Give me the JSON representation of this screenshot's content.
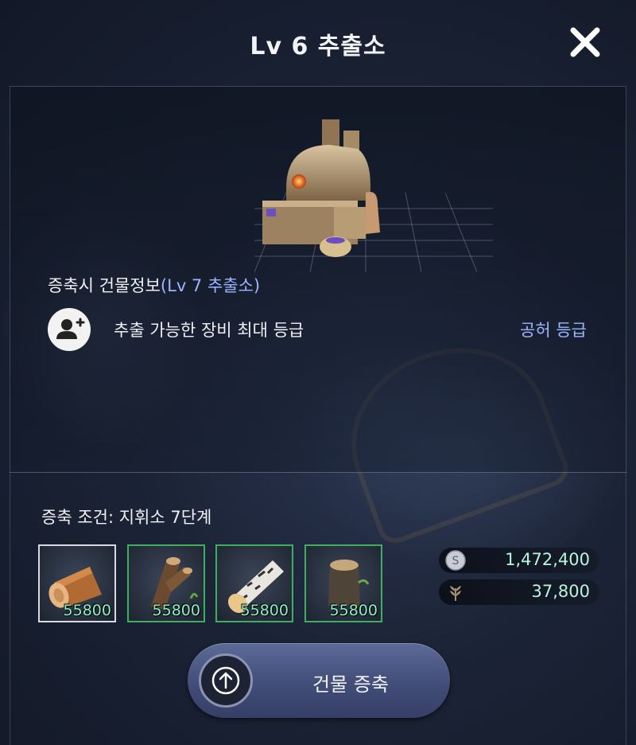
{
  "header": {
    "title": "Lv 6 추출소",
    "close_icon": "close-icon"
  },
  "building_info": {
    "heading_prefix": "증축시 건물정보",
    "heading_accent": "(Lv 7 추출소)",
    "stat_icon": "user-plus-icon",
    "stat_label": "추출 가능한 장비 최대 등급",
    "stat_value": "공허 등급"
  },
  "requirement": {
    "label": "증축 조건: 지휘소 7단계",
    "materials": [
      {
        "icon": "log-icon",
        "quantity": "55800",
        "selected": true
      },
      {
        "icon": "branching-log-icon",
        "quantity": "55800",
        "selected": false
      },
      {
        "icon": "birch-log-icon",
        "quantity": "55800",
        "selected": false
      },
      {
        "icon": "tree-stump-icon",
        "quantity": "55800",
        "selected": false
      }
    ],
    "costs": [
      {
        "icon": "silver-coin-icon",
        "value": "1,472,400"
      },
      {
        "icon": "grain-icon",
        "value": "37,800"
      }
    ]
  },
  "action": {
    "label": "건물 증축",
    "icon": "up-arrow-icon"
  },
  "colors": {
    "accent": "#9db5ff",
    "quantity": "#8ef0c8",
    "green_border": "#3fae63"
  }
}
